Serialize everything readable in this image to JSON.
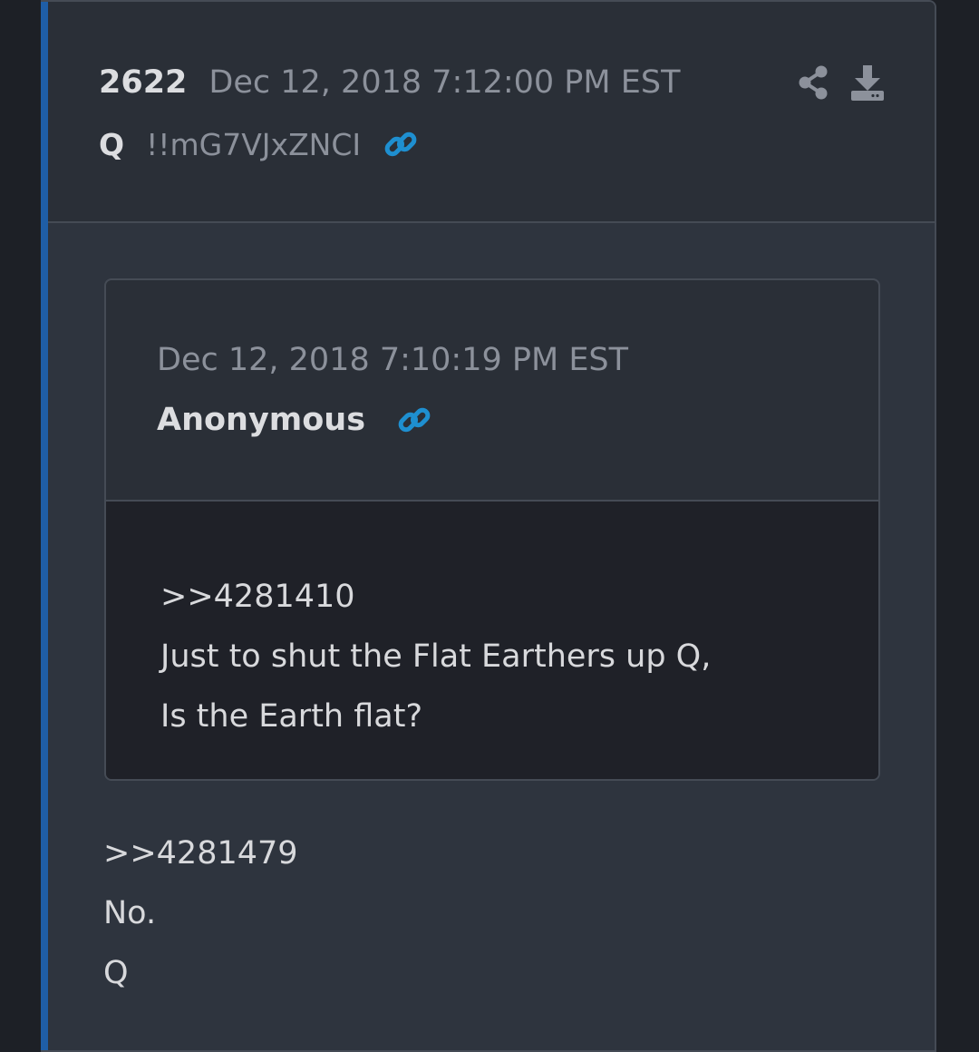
{
  "post": {
    "number": "2622",
    "date": "Dec 12, 2018 7:12:00 PM EST",
    "author": "Q",
    "tripcode": "!!mG7VJxZNCI",
    "icons": {
      "link": "link-icon",
      "share": "share-icon",
      "download": "download-icon"
    },
    "body": [
      ">>4281479",
      "No.",
      "Q"
    ]
  },
  "quoted_post": {
    "date": "Dec 12, 2018 7:10:19 PM EST",
    "author": "Anonymous",
    "icons": {
      "link": "link-icon"
    },
    "body": [
      ">>4281410",
      "Just to shut the Flat Earthers up Q,",
      "Is the Earth flat?"
    ]
  },
  "colors": {
    "accent_bar": "#1f5ea6",
    "link_icon": "#1e8fd0",
    "page_bg": "#1d2026",
    "card_bg": "#2e343e",
    "header_bg": "#2a2f37",
    "quote_body_bg": "#1f2128",
    "muted_text": "#8c919b",
    "primary_text": "#dcdde0"
  }
}
